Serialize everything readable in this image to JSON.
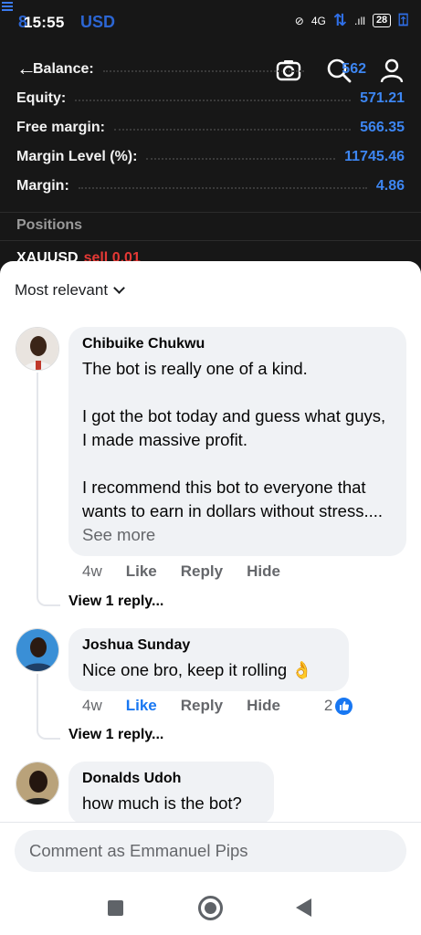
{
  "status_bar": {
    "time": "15:55",
    "ghost_text": "8",
    "ghost_symbol": "USD",
    "network": "4G",
    "battery": "28"
  },
  "account": {
    "rows": [
      {
        "label": "Balance:",
        "value": "562"
      },
      {
        "label": "Equity:",
        "value": "571.21"
      },
      {
        "label": "Free margin:",
        "value": "566.35"
      },
      {
        "label": "Margin Level (%):",
        "value": "11745.46"
      },
      {
        "label": "Margin:",
        "value": "4.86"
      }
    ],
    "positions_label": "Positions",
    "position": {
      "symbol": "XAUUSD",
      "side": "sell 0.01"
    }
  },
  "comments": {
    "sort_label": "Most relevant",
    "items": [
      {
        "author": "Chibuike Chukwu",
        "paragraphs": [
          "The bot is really one of a kind.",
          "I got the bot today and guess what guys, I made massive profit.",
          "I recommend this bot to everyone that wants to earn in dollars without stress...."
        ],
        "see_more": "See more",
        "age": "4w",
        "like": "Like",
        "reply": "Reply",
        "hide": "Hide",
        "view_replies": "View 1 reply..."
      },
      {
        "author": "Joshua Sunday",
        "text": "Nice one bro, keep it rolling",
        "emoji": "👌",
        "age": "4w",
        "like": "Like",
        "reply": "Reply",
        "hide": "Hide",
        "reactions": "2",
        "view_replies": "View 1 reply..."
      },
      {
        "author": "Donalds Udoh",
        "text": "how much is the bot?"
      }
    ],
    "composer_placeholder": "Comment as Emmanuel Pips"
  },
  "colors": {
    "accent_blue": "#1877f2",
    "trade_value_blue": "#3d86f2",
    "sell_red": "#e53935"
  },
  "icons": [
    "menu-icon",
    "back-arrow-icon",
    "camera-icon",
    "search-icon",
    "profile-icon",
    "chevron-down-icon",
    "like-thumb-icon",
    "recent-apps-icon",
    "home-icon",
    "back-icon"
  ]
}
